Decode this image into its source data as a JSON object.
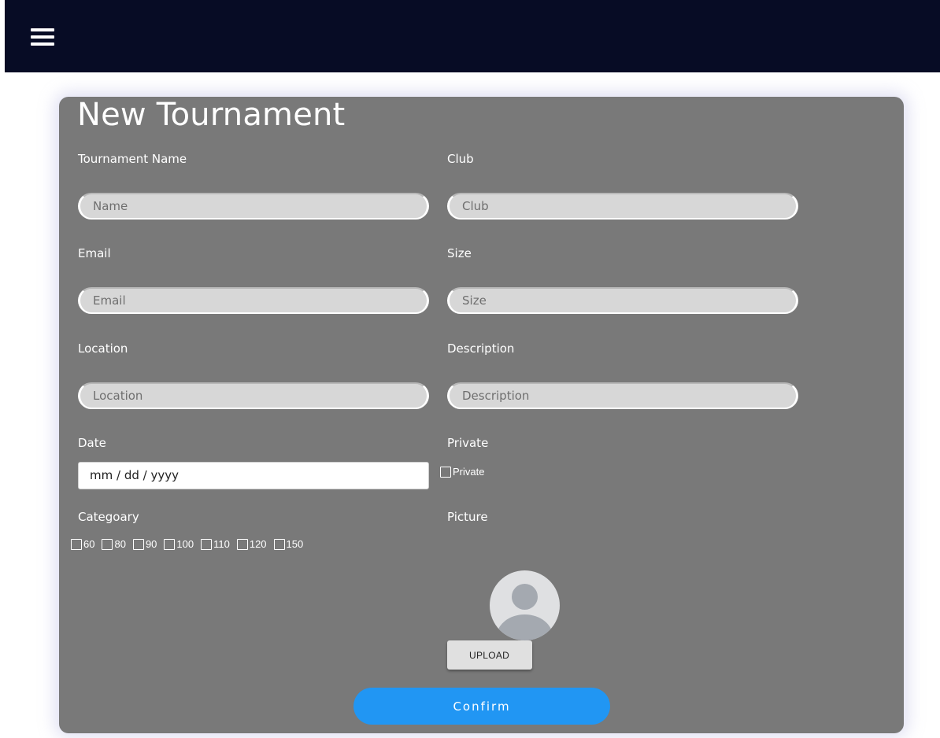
{
  "header": {
    "menu_icon": "hamburger-menu-icon"
  },
  "form": {
    "title": "New Tournament",
    "tournament_name": {
      "label": "Tournament Name",
      "placeholder": "Name"
    },
    "club": {
      "label": "Club",
      "placeholder": "Club"
    },
    "email": {
      "label": "Email",
      "placeholder": "Email"
    },
    "size": {
      "label": "Size",
      "placeholder": "Size"
    },
    "location": {
      "label": "Location",
      "placeholder": "Location"
    },
    "description": {
      "label": "Description",
      "placeholder": "Description"
    },
    "date": {
      "label": "Date",
      "placeholder": "mm / dd / yyyy"
    },
    "private": {
      "label": "Private",
      "checkbox_label": "Private",
      "checked": false
    },
    "category": {
      "label": "Categoary",
      "options": [
        "60",
        "80",
        "90",
        "100",
        "110",
        "120",
        "150"
      ]
    },
    "picture": {
      "label": "Picture",
      "avatar_icon": "user-avatar-icon",
      "upload_label": "UPLOAD"
    },
    "confirm_label": "Confirm"
  },
  "colors": {
    "topbar": "#070c25",
    "card": "#797979",
    "confirm": "#2196f3",
    "input_bg": "#d7d7d7"
  }
}
